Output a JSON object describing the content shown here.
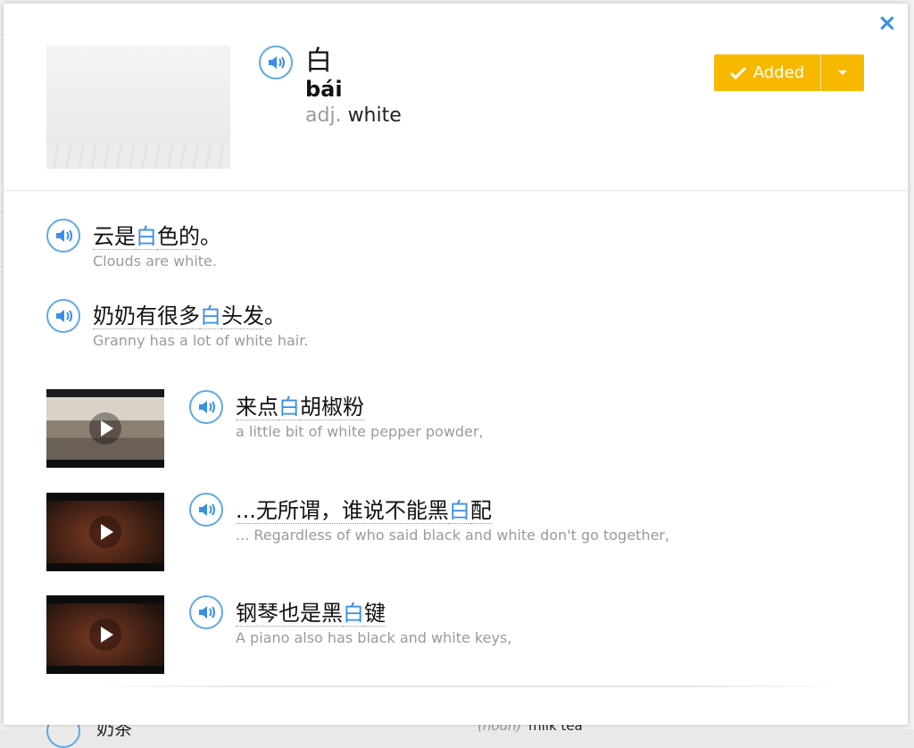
{
  "entry": {
    "hanzi": "白",
    "pinyin": "bái",
    "pos": "adj.",
    "definition": "white",
    "added_label": "Added"
  },
  "sentences": [
    {
      "pre": "云是",
      "word": "白",
      "post": "色的",
      "punct": "。",
      "english": "Clouds are white."
    },
    {
      "pre": "奶奶有很多",
      "word": "白",
      "post": "头发",
      "punct": "。",
      "english": "Granny has a lot of white hair."
    }
  ],
  "videos": [
    {
      "pre": "来点",
      "word": "白",
      "post": "胡椒粉",
      "english": "a little bit of white pepper powder,"
    },
    {
      "pre": "...无所谓，谁说不能黑",
      "word": "白",
      "post": "配",
      "english": "... Regardless of who said black and white don't go together,"
    },
    {
      "pre": "钢琴也是黑",
      "word": "白",
      "post": "键",
      "english": "A piano also has black and white keys,"
    }
  ],
  "background_row": {
    "hanzi": "奶茶",
    "pos": "(noun)",
    "definition": "milk tea"
  },
  "colors": {
    "accent_blue": "#3a8ee6",
    "added_yellow": "#f8b800",
    "muted_text": "#9a9a9a"
  },
  "icons": {
    "close": "close-icon",
    "audio": "speaker-icon",
    "check": "check-icon",
    "caret": "chevron-down-icon",
    "play": "play-icon"
  }
}
